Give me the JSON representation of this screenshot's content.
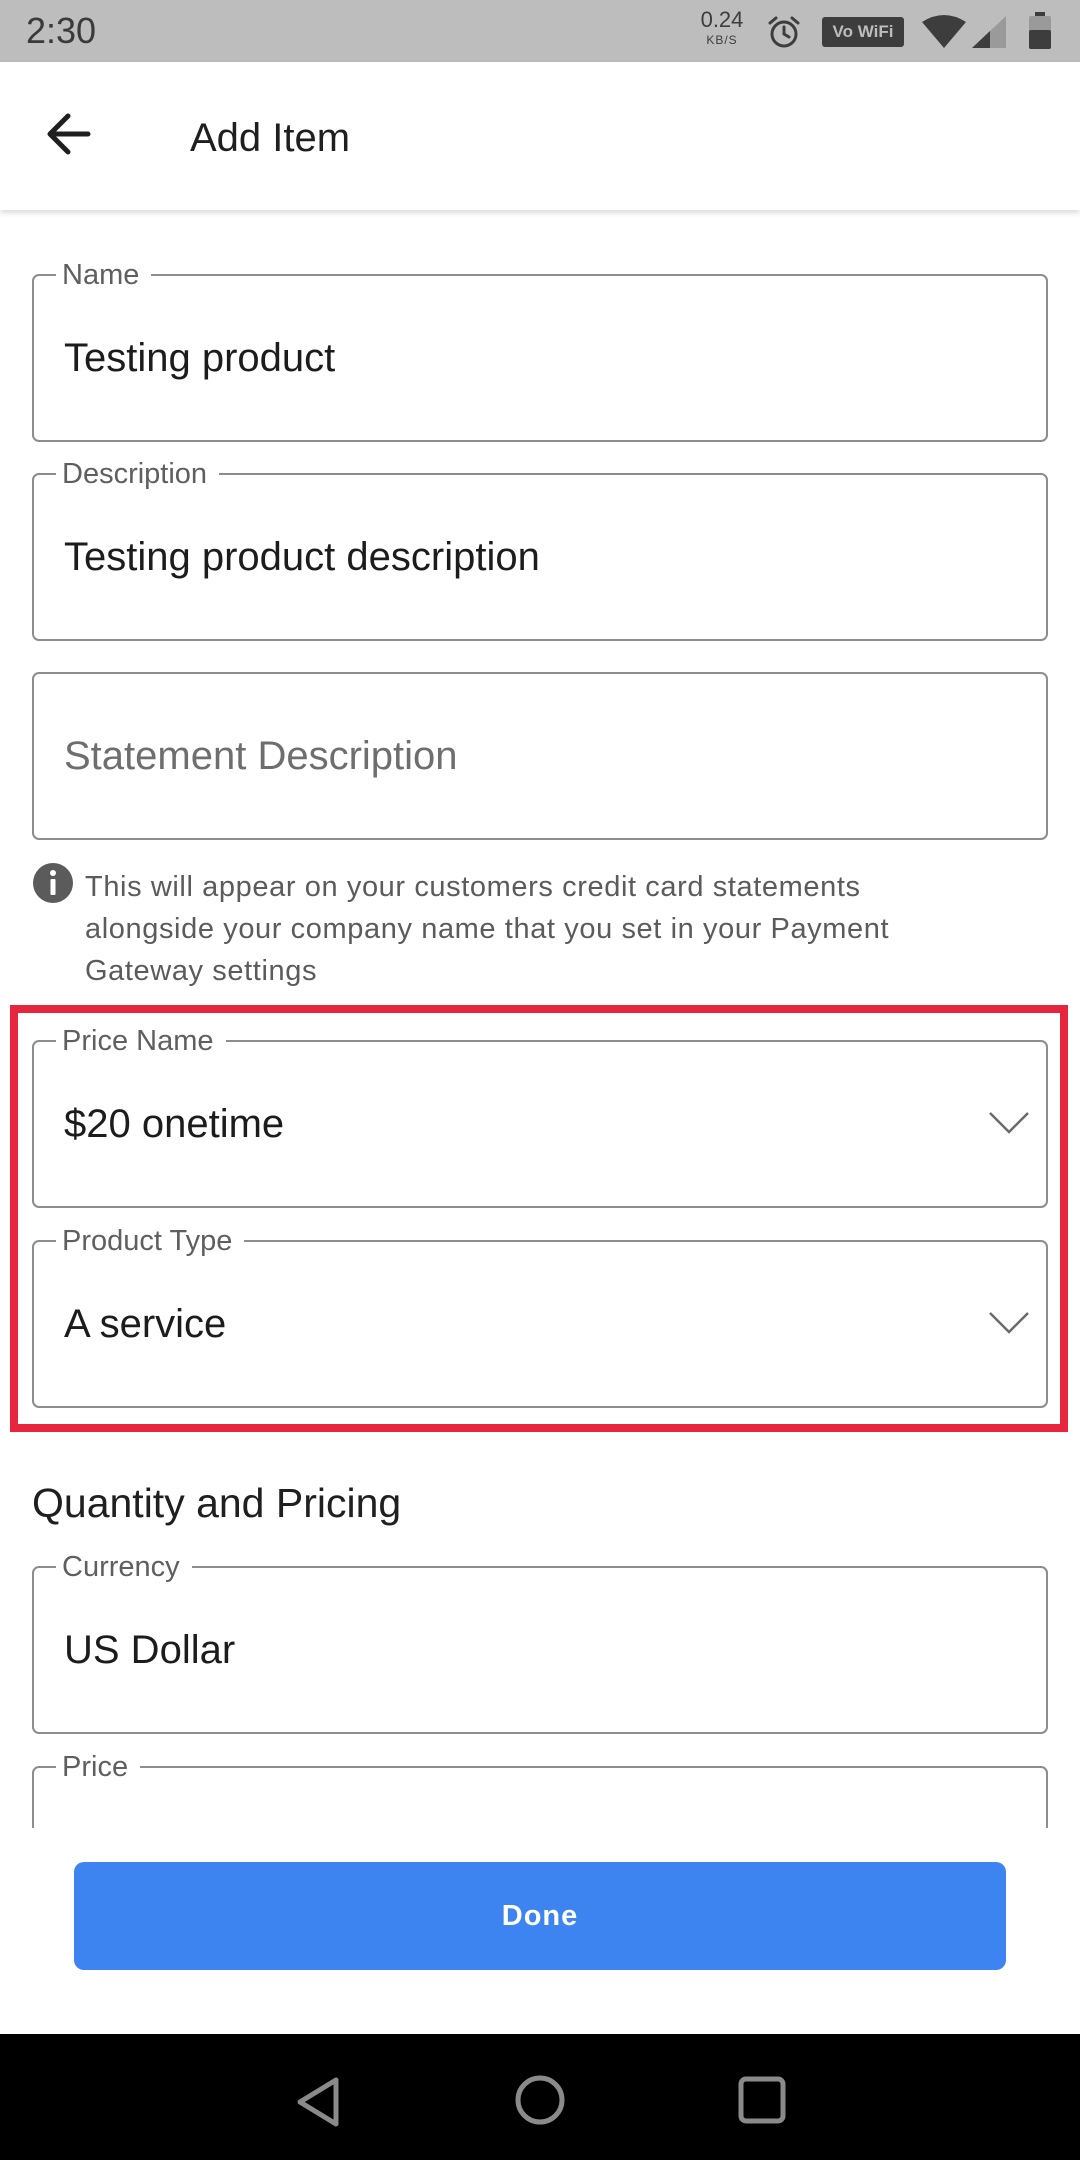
{
  "status_bar": {
    "time": "2:30",
    "speed_value": "0.24",
    "speed_unit": "KB/S",
    "vowifi_label": "Vo WiFi",
    "icons": [
      "alarm-icon",
      "wifi-icon",
      "signal-icon",
      "battery-icon"
    ]
  },
  "app_bar": {
    "title": "Add Item",
    "back_icon": "arrow-left-icon"
  },
  "form": {
    "name": {
      "label": "Name",
      "value": "Testing product"
    },
    "description": {
      "label": "Description",
      "value": "Testing product description"
    },
    "statement_description": {
      "placeholder": "Statement Description"
    },
    "statement_info": "This will appear on your customers credit card statements alongside your company name that you set in your Payment Gateway settings",
    "price_name": {
      "label": "Price Name",
      "value": "$20 onetime"
    },
    "product_type": {
      "label": "Product Type",
      "value": "A service"
    }
  },
  "quantity_section": {
    "title": "Quantity and Pricing",
    "currency": {
      "label": "Currency",
      "value": "US Dollar"
    },
    "price": {
      "label": "Price"
    }
  },
  "done_button": {
    "label": "Done"
  },
  "colors": {
    "accent_button": "#3e84f1",
    "highlight_border": "#e8253f",
    "status_bar": "#bdbdbd",
    "nav_bar": "#000000"
  }
}
